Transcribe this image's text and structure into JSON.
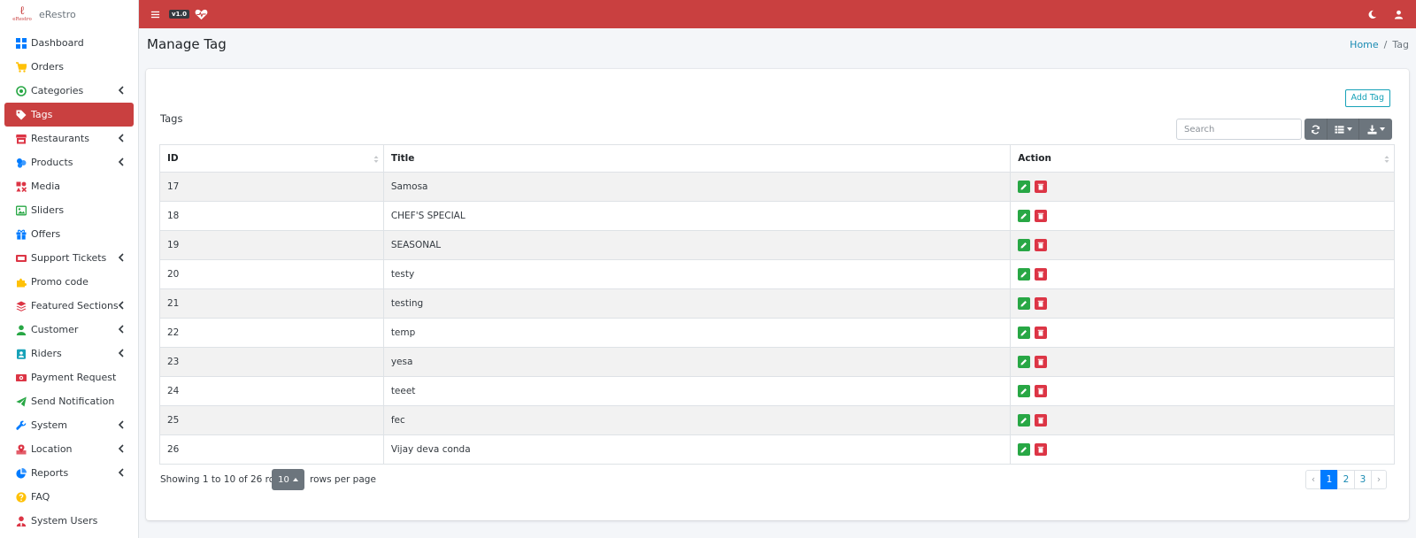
{
  "brand": {
    "logo_text": "eRestro",
    "name": "eRestro"
  },
  "sidebar": {
    "items": [
      {
        "label": "Dashboard",
        "icon": "dashboard-icon",
        "color": "#007bff",
        "chevron": false,
        "active": false
      },
      {
        "label": "Orders",
        "icon": "cart-icon",
        "color": "#ffc107",
        "chevron": false,
        "active": false
      },
      {
        "label": "Categories",
        "icon": "categories-icon",
        "color": "#28a745",
        "chevron": true,
        "active": false
      },
      {
        "label": "Tags",
        "icon": "tag-icon",
        "color": "#ffffff",
        "chevron": false,
        "active": true
      },
      {
        "label": "Restaurants",
        "icon": "store-icon",
        "color": "#dc3545",
        "chevron": true,
        "active": false
      },
      {
        "label": "Products",
        "icon": "products-icon",
        "color": "#007bff",
        "chevron": true,
        "active": false
      },
      {
        "label": "Media",
        "icon": "media-icon",
        "color": "#dc3545",
        "chevron": false,
        "active": false
      },
      {
        "label": "Sliders",
        "icon": "image-icon",
        "color": "#28a745",
        "chevron": false,
        "active": false
      },
      {
        "label": "Offers",
        "icon": "gift-icon",
        "color": "#007bff",
        "chevron": false,
        "active": false
      },
      {
        "label": "Support Tickets",
        "icon": "ticket-icon",
        "color": "#dc3545",
        "chevron": true,
        "active": false
      },
      {
        "label": "Promo code",
        "icon": "puzzle-icon",
        "color": "#ffc107",
        "chevron": false,
        "active": false
      },
      {
        "label": "Featured Sections",
        "icon": "layers-icon",
        "color": "#dc3545",
        "chevron": true,
        "active": false
      },
      {
        "label": "Customer",
        "icon": "user-icon",
        "color": "#28a745",
        "chevron": true,
        "active": false
      },
      {
        "label": "Riders",
        "icon": "id-badge-icon",
        "color": "#17a2b8",
        "chevron": true,
        "active": false
      },
      {
        "label": "Payment Request",
        "icon": "money-icon",
        "color": "#dc3545",
        "chevron": false,
        "active": false
      },
      {
        "label": "Send Notification",
        "icon": "paper-plane-icon",
        "color": "#28a745",
        "chevron": false,
        "active": false
      },
      {
        "label": "System",
        "icon": "wrench-icon",
        "color": "#007bff",
        "chevron": true,
        "active": false
      },
      {
        "label": "Location",
        "icon": "map-marker-icon",
        "color": "#dc3545",
        "chevron": true,
        "active": false
      },
      {
        "label": "Reports",
        "icon": "pie-chart-icon",
        "color": "#007bff",
        "chevron": true,
        "active": false
      },
      {
        "label": "FAQ",
        "icon": "question-icon",
        "color": "#ffc107",
        "chevron": false,
        "active": false
      },
      {
        "label": "System Users",
        "icon": "users-icon",
        "color": "#dc3545",
        "chevron": false,
        "active": false
      }
    ]
  },
  "topbar": {
    "version": "v1.0",
    "bg": "#c94040"
  },
  "page": {
    "title": "Manage Tag"
  },
  "breadcrumb": {
    "home": "Home",
    "sep": "/",
    "current": "Tag"
  },
  "card": {
    "title": "Tags",
    "add_label": "Add Tag",
    "search_placeholder": "Search"
  },
  "table": {
    "columns": [
      "ID",
      "Title",
      "Action"
    ],
    "rows": [
      {
        "id": "17",
        "title": "Samosa"
      },
      {
        "id": "18",
        "title": "CHEF'S SPECIAL"
      },
      {
        "id": "19",
        "title": "SEASONAL"
      },
      {
        "id": "20",
        "title": "testy"
      },
      {
        "id": "21",
        "title": "testing"
      },
      {
        "id": "22",
        "title": "temp"
      },
      {
        "id": "23",
        "title": "yesa"
      },
      {
        "id": "24",
        "title": "teeet"
      },
      {
        "id": "25",
        "title": "fec"
      },
      {
        "id": "26",
        "title": "Vijay deva conda"
      }
    ]
  },
  "footer": {
    "showing": "Showing 1 to 10 of 26 rows",
    "per_page": "10",
    "per_page_suffix": "rows per page",
    "pages": [
      "‹",
      "1",
      "2",
      "3",
      "›"
    ],
    "active_page": "1"
  }
}
